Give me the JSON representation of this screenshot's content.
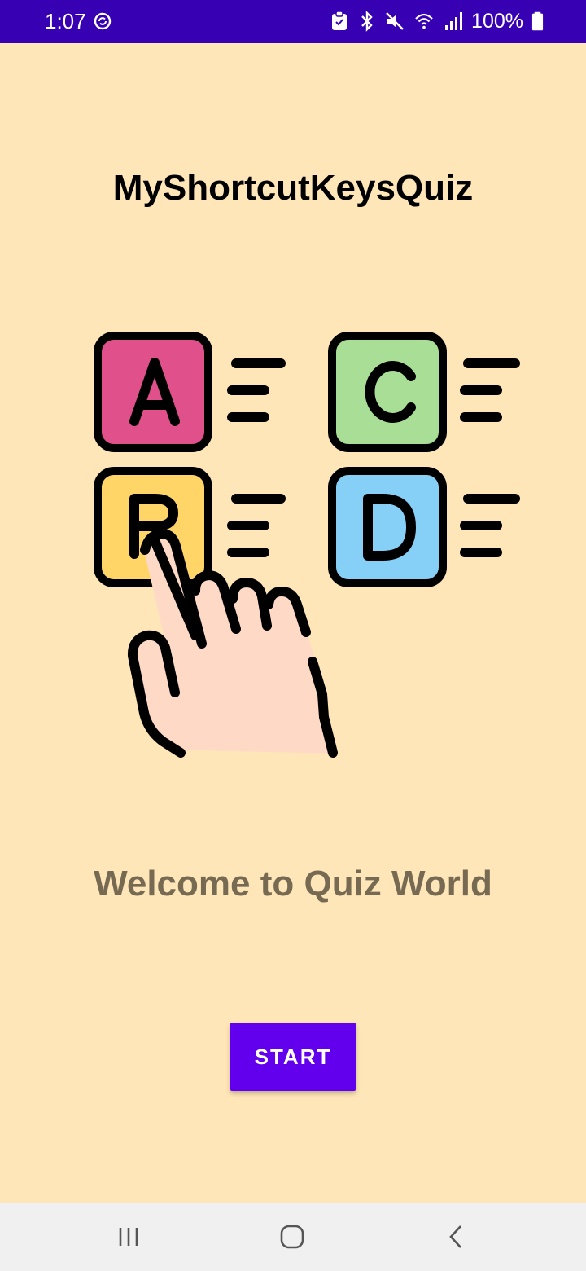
{
  "status_bar": {
    "time": "1:07",
    "battery_percent": "100%",
    "icons": [
      "sync-icon",
      "clipboard-icon",
      "bluetooth-icon",
      "mute-icon",
      "wifi-icon",
      "signal-icon",
      "battery-icon"
    ]
  },
  "app": {
    "title": "MyShortcutKeysQuiz",
    "welcome_text": "Welcome to Quiz World",
    "start_label": "START",
    "accent_color": "#6200EE",
    "background_color": "#FFE6B8"
  },
  "illustration": {
    "options": [
      {
        "letter": "A",
        "color": "#E0508A"
      },
      {
        "letter": "C",
        "color": "#A8DE96"
      },
      {
        "letter": "B",
        "color": "#FFD567"
      },
      {
        "letter": "D",
        "color": "#86D0F8"
      }
    ]
  },
  "nav_bar": {
    "icons": [
      "recent-apps-icon",
      "home-icon",
      "back-icon"
    ]
  }
}
